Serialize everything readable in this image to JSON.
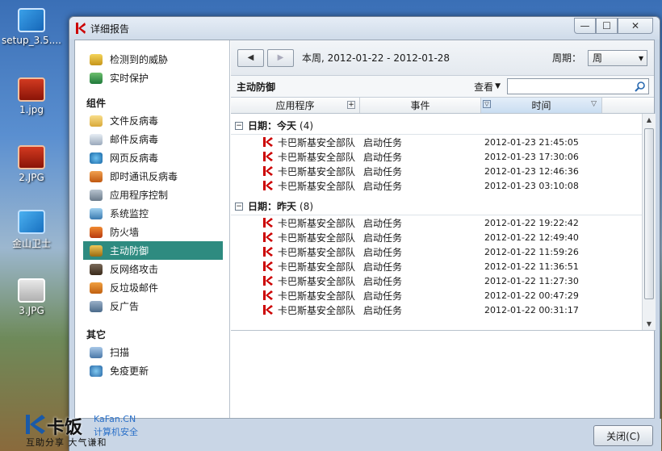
{
  "desktop": {
    "icons": [
      {
        "label": "setup_3.5...."
      },
      {
        "label": "1.jpg"
      },
      {
        "label": "2.JPG"
      },
      {
        "label": "金山卫士"
      },
      {
        "label": "3.JPG"
      }
    ]
  },
  "window": {
    "title": "详细报告",
    "controls": {
      "minimize": "—",
      "maximize": "☐",
      "close": "✕"
    }
  },
  "sidebar": {
    "top_items": [
      {
        "label": "检测到的威胁",
        "icon": "shield-warning-icon"
      },
      {
        "label": "实时保护",
        "icon": "shield-check-icon"
      }
    ],
    "components_heading": "组件",
    "components": [
      {
        "label": "文件反病毒",
        "icon": "folder-icon"
      },
      {
        "label": "邮件反病毒",
        "icon": "mail-icon"
      },
      {
        "label": "网页反病毒",
        "icon": "globe-icon"
      },
      {
        "label": "即时通讯反病毒",
        "icon": "chat-icon"
      },
      {
        "label": "应用程序控制",
        "icon": "funnel-icon"
      },
      {
        "label": "系统监控",
        "icon": "monitor-icon"
      },
      {
        "label": "防火墙",
        "icon": "firewall-icon"
      },
      {
        "label": "主动防御",
        "icon": "shield-icon",
        "active": true
      },
      {
        "label": "反网络攻击",
        "icon": "network-attack-icon"
      },
      {
        "label": "反垃圾邮件",
        "icon": "spam-icon"
      },
      {
        "label": "反广告",
        "icon": "ad-block-icon"
      }
    ],
    "other_heading": "其它",
    "other": [
      {
        "label": "扫描",
        "icon": "scan-icon"
      },
      {
        "label": "免疫更新",
        "icon": "update-icon"
      }
    ]
  },
  "toolbar": {
    "prev": "◀",
    "next": "▶",
    "period_text": "本周, 2012-01-22 - 2012-01-28",
    "period_label": "周期：",
    "period_value": "周"
  },
  "subbar": {
    "title": "主动防御",
    "view_label": "查看",
    "search_placeholder": ""
  },
  "table": {
    "columns": [
      "应用程序",
      "事件",
      "时间"
    ],
    "groups": [
      {
        "label": "日期：今天",
        "count": "(4)",
        "rows": [
          {
            "app": "卡巴斯基安全部队",
            "event": "启动任务",
            "time": "2012-01-23 21:45:05"
          },
          {
            "app": "卡巴斯基安全部队",
            "event": "启动任务",
            "time": "2012-01-23 17:30:06"
          },
          {
            "app": "卡巴斯基安全部队",
            "event": "启动任务",
            "time": "2012-01-23 12:46:36"
          },
          {
            "app": "卡巴斯基安全部队",
            "event": "启动任务",
            "time": "2012-01-23 03:10:08"
          }
        ]
      },
      {
        "label": "日期：昨天",
        "count": "(8)",
        "rows": [
          {
            "app": "卡巴斯基安全部队",
            "event": "启动任务",
            "time": "2012-01-22 19:22:42"
          },
          {
            "app": "卡巴斯基安全部队",
            "event": "启动任务",
            "time": "2012-01-22 12:49:40"
          },
          {
            "app": "卡巴斯基安全部队",
            "event": "启动任务",
            "time": "2012-01-22 11:59:26"
          },
          {
            "app": "卡巴斯基安全部队",
            "event": "启动任务",
            "time": "2012-01-22 11:36:51"
          },
          {
            "app": "卡巴斯基安全部队",
            "event": "启动任务",
            "time": "2012-01-22 11:27:30"
          },
          {
            "app": "卡巴斯基安全部队",
            "event": "启动任务",
            "time": "2012-01-22 00:47:29"
          },
          {
            "app": "卡巴斯基安全部队",
            "event": "启动任务",
            "time": "2012-01-22 00:31:17"
          }
        ]
      }
    ]
  },
  "footer": {
    "close_label": "关闭(C)"
  },
  "watermark": {
    "brand": "卡饭",
    "site": "KaFan.CN",
    "sub": "计算机安全",
    "slogan": "互助分享  大气谦和"
  }
}
